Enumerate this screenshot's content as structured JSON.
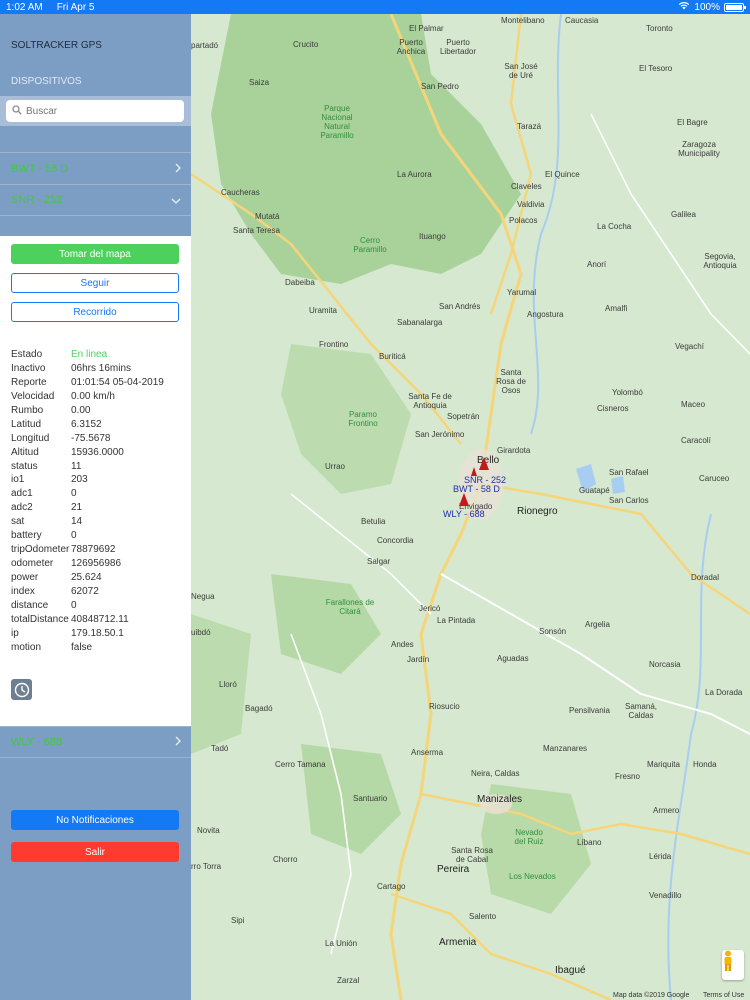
{
  "status_bar": {
    "time": "1:02 AM",
    "date": "Fri Apr 5",
    "battery": "100%"
  },
  "sidebar": {
    "app_title": "SOLTRACKER GPS",
    "section_title": "DISPOSITIVOS",
    "search": {
      "placeholder": "Buscar",
      "value": ""
    },
    "devices": [
      {
        "label": "BWT - 58 D",
        "state": "collapsed"
      },
      {
        "label": "SNR - 252",
        "state": "expanded"
      },
      {
        "label": "WLY - 688",
        "state": "collapsed"
      }
    ],
    "panel": {
      "btn_take_map": "Tomar del mapa",
      "btn_follow": "Seguir",
      "btn_route": "Recorrido",
      "info": [
        {
          "k": "Estado",
          "v": "En linea"
        },
        {
          "k": "Inactivo",
          "v": "06hrs 16mins"
        },
        {
          "k": "Reporte",
          "v": "01:01:54 05-04-2019"
        },
        {
          "k": "Velocidad",
          "v": "0.00 km/h"
        },
        {
          "k": "Rumbo",
          "v": "0.00"
        },
        {
          "k": "Latitud",
          "v": "6.3152"
        },
        {
          "k": "Longitud",
          "v": "-75.5678"
        },
        {
          "k": "Altitud",
          "v": "15936.0000"
        },
        {
          "k": "status",
          "v": "11"
        },
        {
          "k": "io1",
          "v": "203"
        },
        {
          "k": "adc1",
          "v": "0"
        },
        {
          "k": "adc2",
          "v": "21"
        },
        {
          "k": "sat",
          "v": "14"
        },
        {
          "k": "battery",
          "v": "0"
        },
        {
          "k": "tripOdometer",
          "v": "78879692"
        },
        {
          "k": "odometer",
          "v": "126956986"
        },
        {
          "k": "power",
          "v": "25.624"
        },
        {
          "k": "index",
          "v": "62072"
        },
        {
          "k": "distance",
          "v": "0"
        },
        {
          "k": "totalDistance",
          "v": "40848712.11"
        },
        {
          "k": "ip",
          "v": "179.18.50.1"
        },
        {
          "k": "motion",
          "v": "false"
        }
      ]
    },
    "btn_notifications": "No Notificaciones",
    "btn_exit": "Salir"
  },
  "map": {
    "places": [
      "Montelibano",
      "Caucasia",
      "Toronto",
      "El Palmar",
      "Puerto Anchica",
      "Puerto Libertador",
      "partadó",
      "Crucito",
      "San José de Uré",
      "El Tesoro",
      "Saiza",
      "San Pedro",
      "Parque Nacional Natural Paramillo",
      "Tarazá",
      "El Bagre",
      "Zaragoza Municipality",
      "Caucheras",
      "El Quince",
      "La Aurora",
      "Claveles",
      "Mutatá",
      "Valdivia",
      "Galilea",
      "Santa Teresa",
      "Polacos",
      "La Cocha",
      "Cerro Paramillo",
      "Ituango",
      "Segovia, Antioquia",
      "Anorí",
      "Dabeiba",
      "Yarumal",
      "Uramita",
      "San Andrés",
      "Angostura",
      "Amalfi",
      "Sabanalarga",
      "Frontino",
      "Buriticá",
      "Vegachí",
      "Santa Rosa de Osos",
      "Yolombó",
      "Santa Fe de Antioquia",
      "Paramo Frontino",
      "Sopetrán",
      "Cisneros",
      "Maceo",
      "San Jerónimo",
      "Girardota",
      "Caracolí",
      "Urrao",
      "Bello",
      "San Rafael",
      "Guatapé",
      "Caruceo",
      "San Carlos",
      "Rionegro",
      "Envigado",
      "Betulia",
      "Concordia",
      "Salgar",
      "Doradal",
      "Negua",
      "Farallones de Citará",
      "Jericó",
      "uibdó",
      "La Pintada",
      "Andes",
      "Sonsón",
      "Argelia",
      "Jardín",
      "Aguadas",
      "Norcasia",
      "Lloró",
      "La Dorada",
      "Bagadó",
      "Riosucio",
      "Pensilvania",
      "Samaná, Caldas",
      "Tadó",
      "Anserma",
      "Manzanares",
      "Cerro Tamana",
      "Mariquita",
      "Honda",
      "Neira, Caldas",
      "Fresno",
      "Santuario",
      "Manizales",
      "Armero",
      "Novita",
      "Nevado del Ruiz",
      "Santa Rosa de Cabal",
      "Líbano",
      "rro Torra",
      "Chorro",
      "Pereira",
      "Los Nevados",
      "Lérida",
      "Cartago",
      "Venadillo",
      "Sipi",
      "Salento",
      "La Unión",
      "Armenia",
      "Zarzal",
      "Ibagué"
    ],
    "markers": [
      "SNR - 252",
      "BWT - 58 D",
      "WLY - 688"
    ],
    "attribution": "Map data ©2019 Google",
    "terms": "Terms of Use"
  }
}
